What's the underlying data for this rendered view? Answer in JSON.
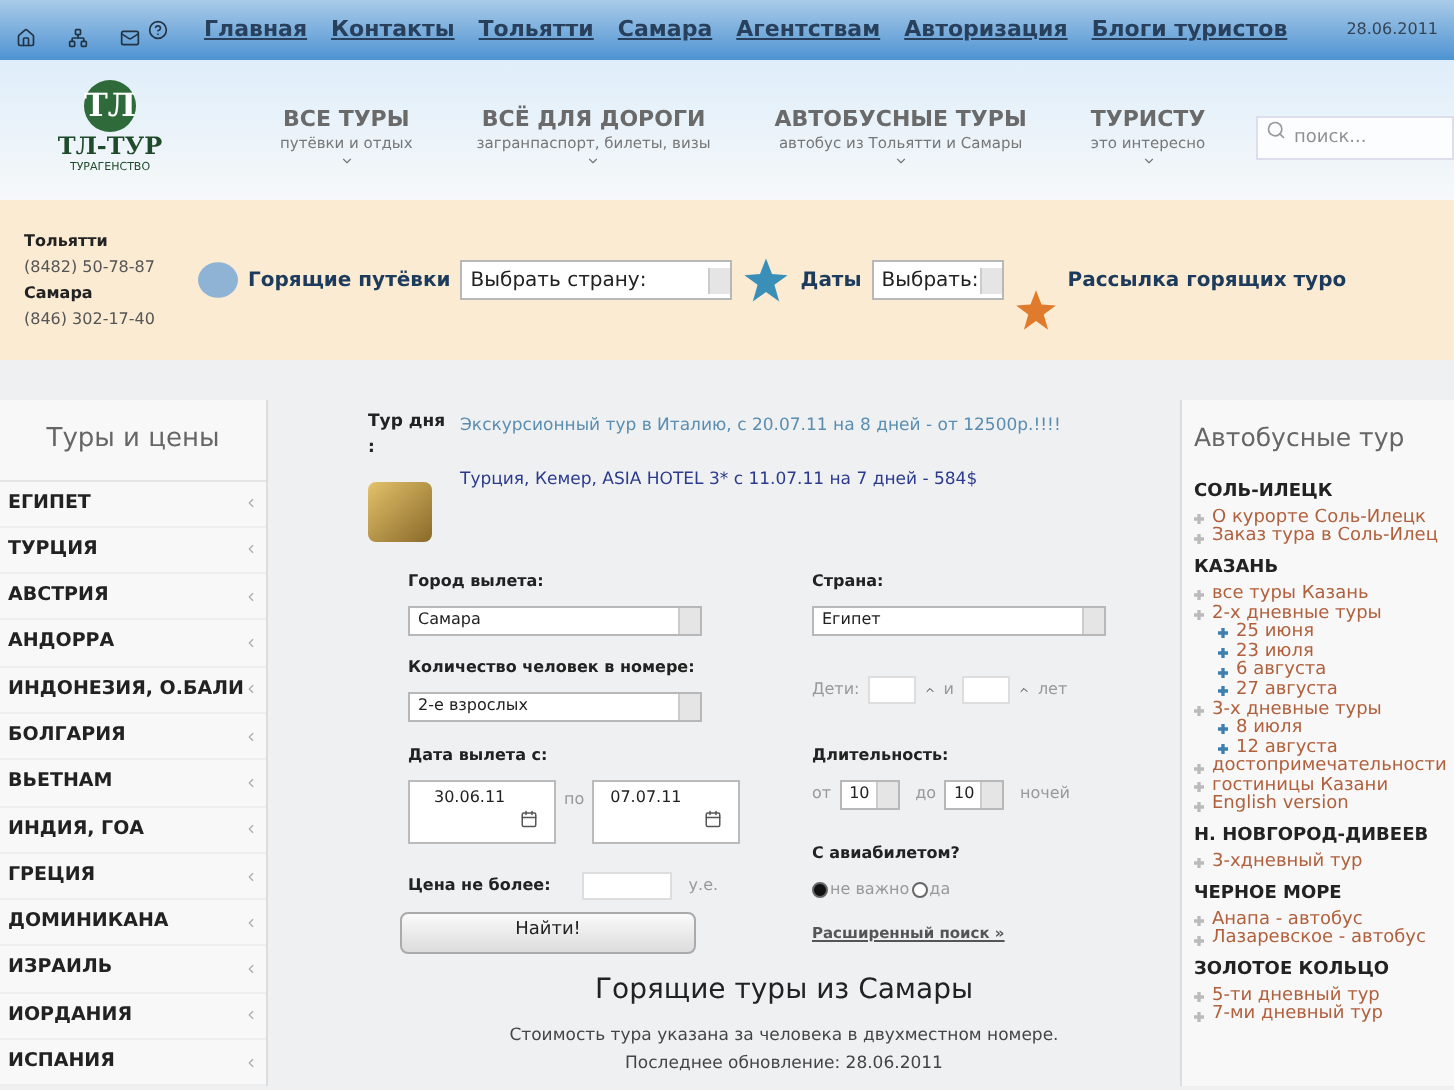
{
  "top_bar": {
    "nav": [
      "Главная",
      "Контакты",
      "Тольятти",
      "Самара",
      "Агентствам",
      "Авторизация",
      "Блоги туристов"
    ],
    "date": "28.06.2011"
  },
  "header": {
    "logo": {
      "mark": "ТЛ",
      "name": "ТЛ-ТУР",
      "tagline": "ТУРАГЕНСТВО"
    },
    "menu": [
      {
        "title": "ВСЕ ТУРЫ",
        "subtitle": "путёвки и отдых"
      },
      {
        "title": "ВСЁ ДЛЯ ДОРОГИ",
        "subtitle": "загранпаспорт, билеты, визы"
      },
      {
        "title": "АВТОБУСНЫЕ ТУРЫ",
        "subtitle": "автобус из Тольятти и Самары"
      },
      {
        "title": "ТУРИСТУ",
        "subtitle": "это интересно"
      }
    ],
    "search": {
      "placeholder": "поиск..."
    }
  },
  "strip": {
    "contacts": [
      {
        "city": "Тольятти",
        "phone": "(8482) 50-78-87"
      },
      {
        "city": "Самара",
        "phone": "(846) 302-17-40"
      }
    ],
    "hot": {
      "label": "Горящие путёвки",
      "select": "Выбрать страну:"
    },
    "dates": {
      "label": "Даты",
      "select": "Выбрать:"
    },
    "mailing": "Рассылка горящих туро"
  },
  "sidebar": {
    "title": "Туры и цены",
    "items": [
      "ЕГИПЕТ",
      "ТУРЦИЯ",
      "АВСТРИЯ",
      "АНДОРРА",
      "ИНДОНЕЗИЯ, О.БАЛИ",
      "БОЛГАРИЯ",
      "ВЬЕТНАМ",
      "ИНДИЯ, ГОА",
      "ГРЕЦИЯ",
      "ДОМИНИКАНА",
      "ИЗРАИЛЬ",
      "ИОРДАНИЯ",
      "ИСПАНИЯ"
    ]
  },
  "tour_of_day": {
    "label": "Тур дня :",
    "links": [
      "Экскурсионный тур в Италию, с 20.07.11 на 8 дней - от 12500р.!!!!",
      "Турция, Кемер, ASIA HOTEL 3* с 11.07.11 на 7 дней - 584$"
    ]
  },
  "form": {
    "city": {
      "label": "Город вылета:",
      "value": "Самара"
    },
    "country": {
      "label": "Страна:",
      "value": "Египет"
    },
    "people": {
      "label": "Количество человек в номере:",
      "value": "2-е взрослых"
    },
    "children": {
      "label": "Дети:",
      "and": "и",
      "unit": "лет"
    },
    "dates": {
      "label": "Дата вылета с:",
      "from": "30.06.11",
      "to_label": "по",
      "to": "07.07.11"
    },
    "duration": {
      "label": "Длительность:",
      "from_label": "от",
      "from": "10",
      "to_label": "до",
      "to": "10",
      "unit": "ночей"
    },
    "price": {
      "label": "Цена не более:",
      "unit": "у.е."
    },
    "flight": {
      "label": "С авиабилетом?",
      "options": [
        {
          "label": "не важно",
          "selected": true
        },
        {
          "label": "да",
          "selected": false
        }
      ]
    },
    "submit": "Найти!",
    "advanced": "Расширенный поиск »"
  },
  "hot_tours": {
    "title": "Горящие туры из Самары",
    "note": "Стоимость тура указана за человека в двухместном номере.",
    "updated": "Последнее обновление: 28.06.2011"
  },
  "bus_tours": {
    "title": "Автобусные тур",
    "groups": [
      {
        "title": "СОЛЬ-ИЛЕЦК",
        "items": [
          {
            "label": "О курорте Соль-Илецк"
          },
          {
            "label": "Заказ тура в Соль-Илец"
          }
        ]
      },
      {
        "title": "КАЗАНЬ",
        "items": [
          {
            "label": "все туры Казань"
          },
          {
            "label": "2-х дневные туры",
            "children": [
              {
                "label": "25 июня"
              },
              {
                "label": "23 июля"
              },
              {
                "label": "6 августа"
              },
              {
                "label": "27 августа"
              }
            ]
          },
          {
            "label": "3-х дневные туры",
            "children": [
              {
                "label": "8 июля"
              },
              {
                "label": "12 августа"
              }
            ]
          },
          {
            "label": "достопримечательности"
          },
          {
            "label": "гостиницы Казани"
          },
          {
            "label": "English version"
          }
        ]
      },
      {
        "title": "Н. НОВГОРОД-ДИВЕЕВ",
        "items": [
          {
            "label": "3-хдневный тур"
          }
        ]
      },
      {
        "title": "ЧЕРНОЕ МОРЕ",
        "items": [
          {
            "label": "Анапа - автобус"
          },
          {
            "label": "Лазаревское - автобус"
          }
        ]
      },
      {
        "title": "ЗОЛОТОЕ КОЛЬЦО",
        "items": [
          {
            "label": "5-ти дневный тур"
          },
          {
            "label": "7-ми дневный тур"
          }
        ]
      }
    ]
  }
}
